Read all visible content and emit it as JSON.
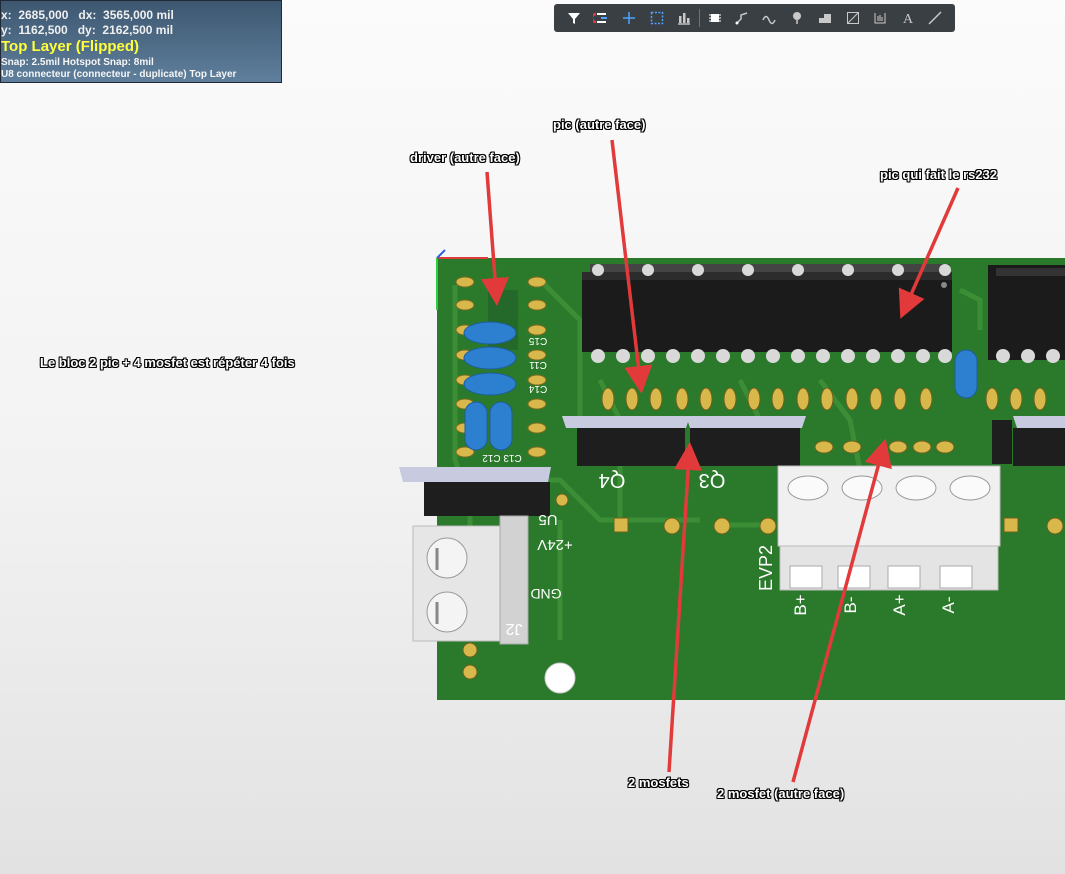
{
  "hud": {
    "line1": "x:  2685,000   dx:  3565,000 mil",
    "line2": "y:  1162,500   dy:  2162,500 mil",
    "layer": "Top Layer (Flipped)",
    "snap": "Snap: 2.5mil Hotspot Snap: 8mil",
    "component": "U8 connecteur (connecteur - duplicate) Top Layer"
  },
  "toolbar": {
    "tools": [
      "filter-icon",
      "magnet-icon",
      "crosshair-icon",
      "select-rect-icon",
      "align-icon",
      "component-icon",
      "route-icon",
      "diff-pair-icon",
      "via-icon",
      "polygon-icon",
      "keepout-icon",
      "dimension-icon",
      "text-icon",
      "line-icon"
    ]
  },
  "annotations": {
    "driver": "driver (autre face)",
    "pic": "pic (autre face)",
    "pic_rs232": "pic qui fait le rs232",
    "bloc": "Le bloc 2 pic + 4 mosfet est répéter 4 fois",
    "mosfets": "2 mosfets",
    "mosfet_other": "2 mosfet (autre face)"
  },
  "silkscreen": {
    "c15": "C15",
    "c11": "C11",
    "c14": "C14",
    "c13c12": "C13 C12",
    "q4": "Q4",
    "q3": "Q3",
    "u5": "U5",
    "v24": "+24V",
    "gnd": "GND",
    "j2": "J2",
    "evp2": "EVP2",
    "bplus": "B+",
    "bminus": "B-",
    "aplus": "A+",
    "aminus": "A-"
  },
  "colors": {
    "pcb": "#2b7a2b",
    "hud_yellow": "#ffff3c",
    "arrow": "#e23a3a"
  }
}
